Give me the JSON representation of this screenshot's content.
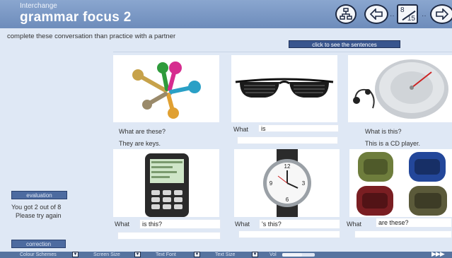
{
  "header": {
    "subtitle": "Interchange",
    "title": "grammar focus 2",
    "page_current": "8",
    "page_total": "15",
    "dots": "··"
  },
  "instruction": "complete these conversation than practice with a partner",
  "sentences_button": "click to see the sentences",
  "left_panel": {
    "evaluation_button": "evaluation",
    "score_text": "You got 2 out of 8",
    "retry_text": "Please try again",
    "correction_button": "correction"
  },
  "cards": [
    {
      "image": "keys-image",
      "q_label": "What are these?",
      "a_label": "They are keys."
    },
    {
      "image": "sunglasses-image",
      "q_label": "What",
      "q_value": "is",
      "a_value": ""
    },
    {
      "image": "cd-player-image",
      "q_label": "What is this?",
      "a_label": "This is a CD player."
    },
    {
      "image": "cellphone-image",
      "q_label": "What",
      "q_value": "is this?",
      "a_value": ""
    },
    {
      "image": "watch-image",
      "q_label": "What",
      "q_value": "'s this?",
      "a_value": ""
    },
    {
      "image": "backpacks-image",
      "q_label": "What",
      "q_value": "are these?",
      "a_value": ""
    }
  ],
  "bottom_bar": {
    "colour_schemes": "Colour Schemes",
    "screen_size": "Screen Size",
    "text_font": "Text Font",
    "text_size": "Text Size",
    "vol": "Vol",
    "volume_level": 0.6,
    "arrows": "▶▶▶"
  },
  "colors": {
    "header": "#7895c3",
    "background": "#dfe8f5",
    "button": "#38558e"
  }
}
